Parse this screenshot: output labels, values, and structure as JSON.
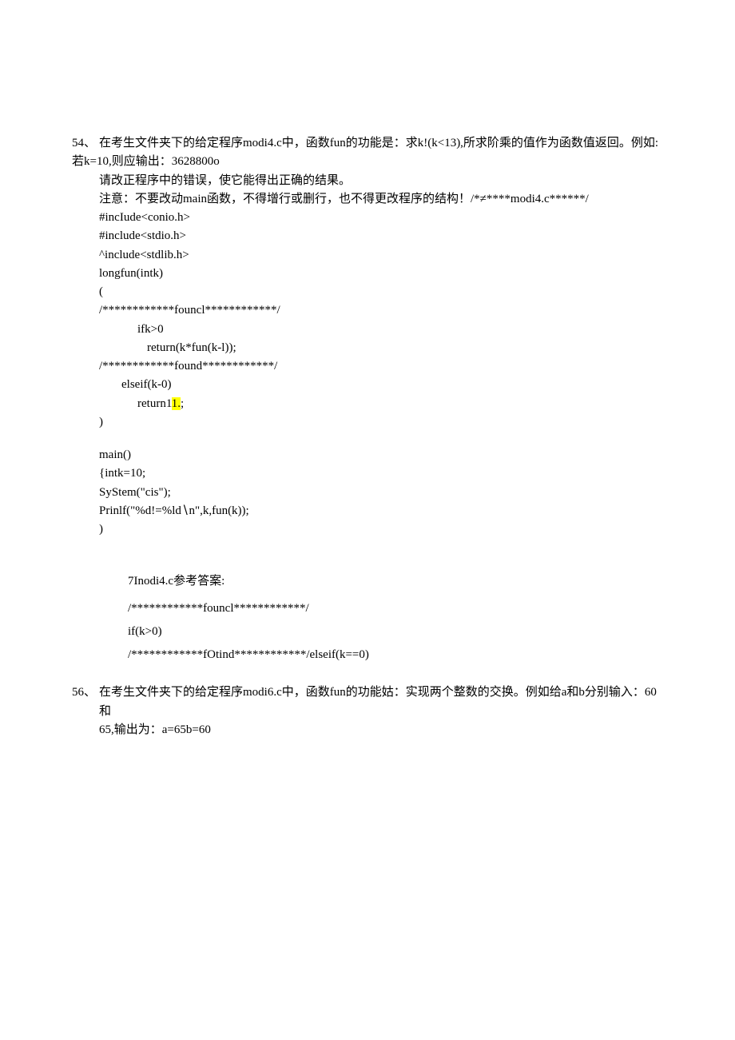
{
  "q54": {
    "num": "54、",
    "line1": "在考生文件夹下的给定程序modi4.c中，函数fun的功能是：求k!(k<13),所求阶乘的值作为函数值返回。例如:",
    "line2": "若k=10,则应输出：3628800o",
    "line3": "请改正程序中的错误，使它能得出正确的结果。",
    "line4": "注意：不要改动main函数，不得增行或删行，也不得更改程序的结构！/*≠****modi4.c******/",
    "code": {
      "c1": "#incIude<conio.h>",
      "c2": "#include<stdio.h>",
      "c3": "^include<stdlib.h>",
      "c4": "longfun(intk)",
      "c5": "(",
      "c6": "/************founcl************/",
      "c7": "ifk>0",
      "c8": "return(k*fun(k-l));",
      "c9": "/************found************/",
      "c10": "elseif(k-0)",
      "c11a": "return1",
      "c11b": "1.",
      "c11c": ";",
      "c12": ")",
      "m1": "main()",
      "m2": "{intk=10;",
      "m3": "SyStem(\"cis\");",
      "m4": "Prinlf(\"%d!=%ld∖n\",k,fun(k));",
      "m5": ")"
    }
  },
  "answer": {
    "title": "7Inodi4.c参考答案:",
    "a1": "/************founcl************/",
    "a2": "if(k>0)",
    "a3": "/************fOtind************/elseif(k==0)"
  },
  "q56": {
    "num": "56、",
    "line1": "在考生文件夹下的给定程序modi6.c中，函数fun的功能姑：实现两个整数的交换。例如给a和b分别输入：60和",
    "line2": "65,输出为：a=65b=60"
  }
}
